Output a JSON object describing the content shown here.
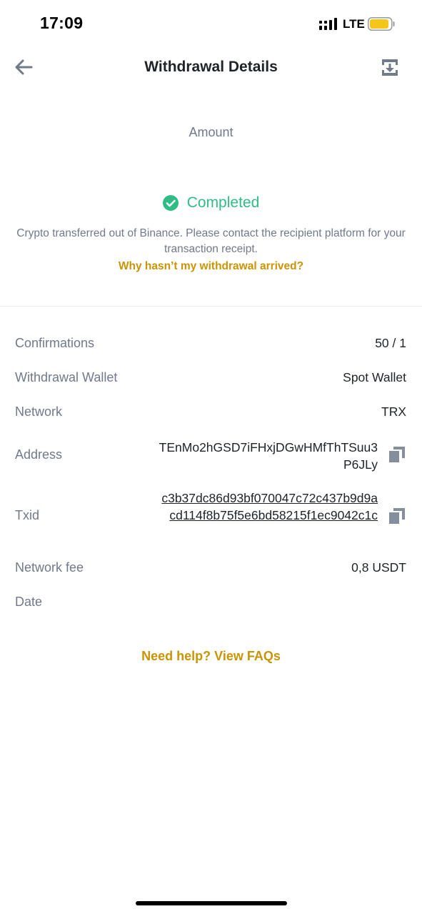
{
  "status_bar": {
    "time": "17:09",
    "network": "LTE",
    "signal_icon": "signal-bars-icon",
    "battery_icon": "battery-icon",
    "battery_color": "#f5c518"
  },
  "header": {
    "title": "Withdrawal Details",
    "back_icon": "arrow-left-icon",
    "download_icon": "download-icon"
  },
  "amount": {
    "label": "Amount"
  },
  "status": {
    "icon": "check-circle-icon",
    "text": "Completed",
    "color": "#2ebd85",
    "description": "Crypto transferred out of Binance. Please contact the recipient platform for your transaction receipt.",
    "help_link": "Why hasn’t my withdrawal arrived?"
  },
  "details": {
    "confirmations": {
      "label": "Confirmations",
      "value": "50 / 1"
    },
    "wallet": {
      "label": "Withdrawal Wallet",
      "value": "Spot Wallet"
    },
    "network": {
      "label": "Network",
      "value": "TRX"
    },
    "address": {
      "label": "Address",
      "value": "TEnMo2hGSD7iFHxjDGwHMfThTSuu3P6JLy",
      "copy_icon": "copy-icon"
    },
    "txid": {
      "label": "Txid",
      "value": "c3b37dc86d93bf070047c72c437b9d9acd114f8b75f5e6bd58215f1ec9042c1c",
      "copy_icon": "copy-icon"
    },
    "fee": {
      "label": "Network fee",
      "value": "0,8 USDT"
    },
    "date": {
      "label": "Date",
      "value": ""
    }
  },
  "footer": {
    "faq_link": "Need help? View FAQs"
  },
  "colors": {
    "accent": "#c99400",
    "muted": "#707a8a",
    "text": "#1e2329",
    "divider": "#eaecef"
  }
}
